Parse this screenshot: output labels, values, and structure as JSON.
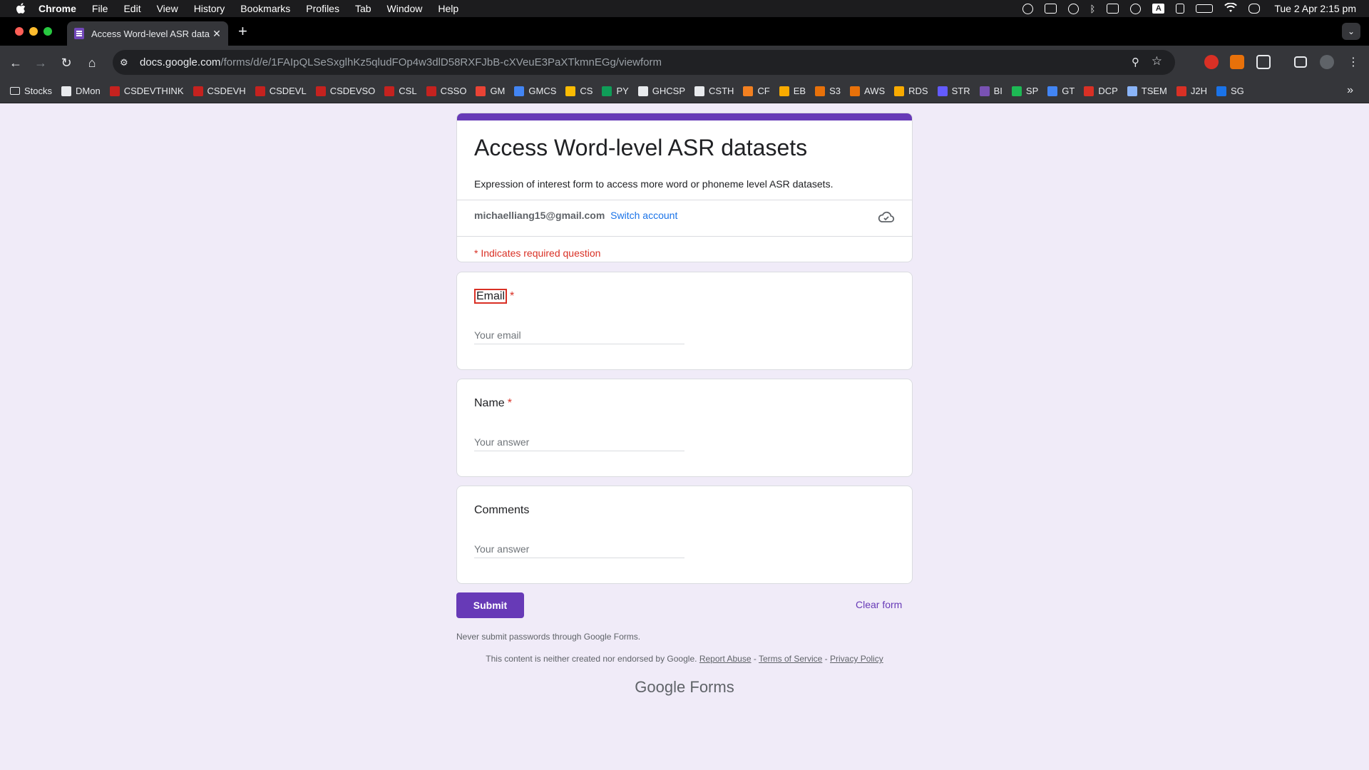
{
  "menubar": {
    "app": "Chrome",
    "items": [
      "File",
      "Edit",
      "View",
      "History",
      "Bookmarks",
      "Profiles",
      "Tab",
      "Window",
      "Help"
    ],
    "status_a": "A",
    "clock": "Tue 2 Apr  2:15 pm"
  },
  "browser": {
    "tab_title": "Access Word-level ASR datas",
    "url_domain": "docs.google.com",
    "url_path": "/forms/d/e/1FAIpQLSeSxglhKz5qludFOp4w3dlD58RXFJbB-cXVeuE3PaXTkmnEGg/viewform"
  },
  "bookmarks": [
    {
      "label": "Stocks",
      "color": "folder"
    },
    {
      "label": "DMon",
      "color": "#e8eaed"
    },
    {
      "label": "CSDEVTHINK",
      "color": "#c5221f"
    },
    {
      "label": "CSDEVH",
      "color": "#c5221f"
    },
    {
      "label": "CSDEVL",
      "color": "#c5221f"
    },
    {
      "label": "CSDEVSO",
      "color": "#c5221f"
    },
    {
      "label": "CSL",
      "color": "#c5221f"
    },
    {
      "label": "CSSO",
      "color": "#c5221f"
    },
    {
      "label": "GM",
      "color": "#ea4335"
    },
    {
      "label": "GMCS",
      "color": "#4285f4"
    },
    {
      "label": "CS",
      "color": "#fbbc04"
    },
    {
      "label": "PY",
      "color": "#0f9d58"
    },
    {
      "label": "GHCSP",
      "color": "#e8eaed"
    },
    {
      "label": "CSTH",
      "color": "#e8eaed"
    },
    {
      "label": "CF",
      "color": "#f38020"
    },
    {
      "label": "EB",
      "color": "#f9ab00"
    },
    {
      "label": "S3",
      "color": "#e8710a"
    },
    {
      "label": "AWS",
      "color": "#e8710a"
    },
    {
      "label": "RDS",
      "color": "#f9ab00"
    },
    {
      "label": "STR",
      "color": "#635bff"
    },
    {
      "label": "BI",
      "color": "#7952b3"
    },
    {
      "label": "SP",
      "color": "#1db954"
    },
    {
      "label": "GT",
      "color": "#4285f4"
    },
    {
      "label": "DCP",
      "color": "#d93025"
    },
    {
      "label": "TSEM",
      "color": "#8ab4f8"
    },
    {
      "label": "J2H",
      "color": "#d93025"
    },
    {
      "label": "SG",
      "color": "#1a73e8"
    }
  ],
  "form": {
    "title": "Access Word-level ASR datasets",
    "description": "Expression of interest form to access more word or phoneme level ASR datasets.",
    "account_email": "michaelliang15@gmail.com",
    "switch_account": "Switch account",
    "required_note": "* Indicates required question",
    "questions": [
      {
        "label": "Email",
        "required_mark": "*",
        "placeholder": "Your email"
      },
      {
        "label": "Name",
        "required_mark": "*",
        "placeholder": "Your answer"
      },
      {
        "label": "Comments",
        "required_mark": "",
        "placeholder": "Your answer"
      }
    ],
    "submit": "Submit",
    "clear": "Clear form",
    "never_submit": "Never submit passwords through Google Forms.",
    "disclaimer": "This content is neither created nor endorsed by Google.",
    "report_abuse": "Report Abuse",
    "terms": "Terms of Service",
    "privacy": "Privacy Policy",
    "sep": " - ",
    "brand_google": "Google",
    "brand_forms": "Forms"
  },
  "colors": {
    "accent": "#673ab7",
    "page_bg": "#f0ebf8",
    "required": "#d93025",
    "link": "#1a73e8"
  }
}
